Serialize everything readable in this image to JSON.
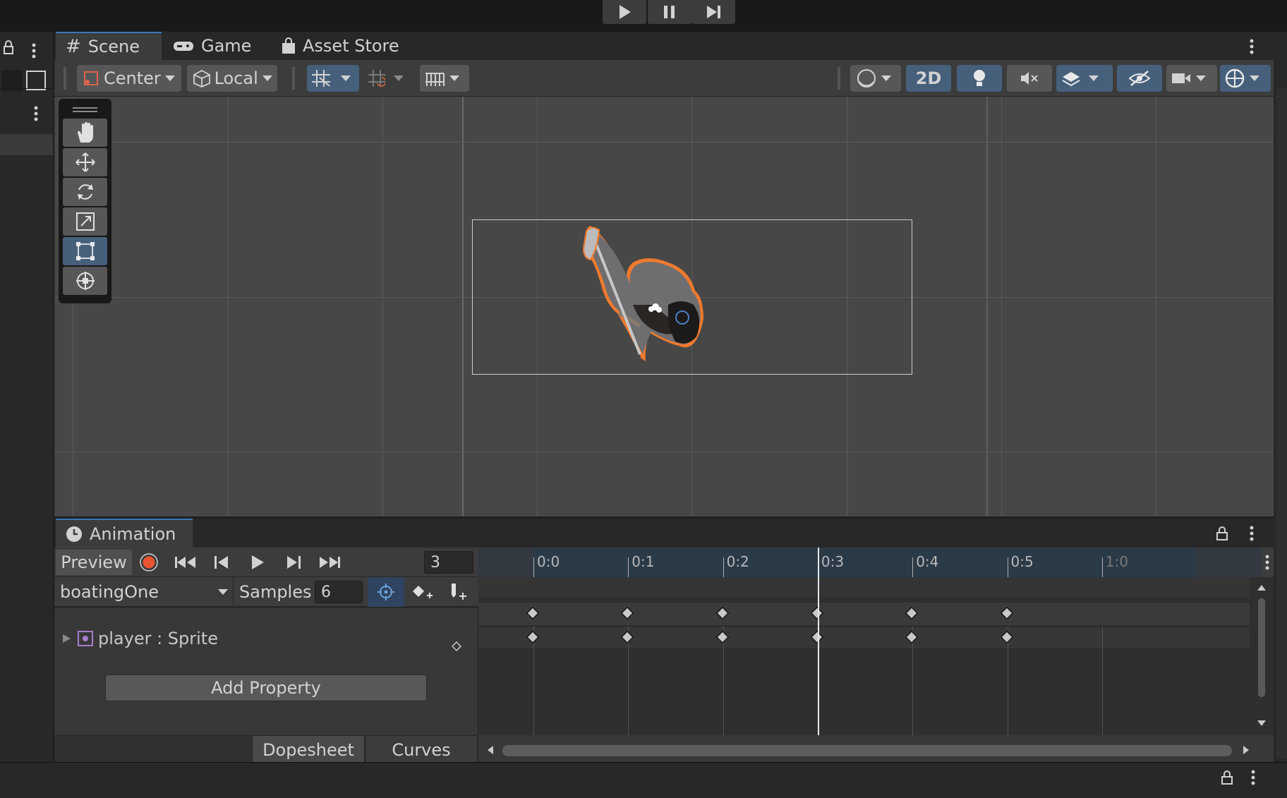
{
  "tabs": [
    "Scene",
    "Game",
    "Asset Store"
  ],
  "toolbar": {
    "pivot": "Center",
    "space": "Local",
    "mode_2d": "2D"
  },
  "animation": {
    "tab": "Animation",
    "preview": "Preview",
    "frame": "3",
    "clip": "boatingOne",
    "samples_label": "Samples",
    "samples": "6",
    "property": "player : Sprite",
    "add_property": "Add Property",
    "dopesheet": "Dopesheet",
    "curves": "Curves",
    "ruler": [
      "0:0",
      "0:1",
      "0:2",
      "0:3",
      "0:4",
      "0:5",
      "1:0"
    ],
    "playhead_frame": 3,
    "keyframes": [
      0,
      1,
      2,
      3,
      4,
      5
    ]
  },
  "colors": {
    "accent": "#46607c",
    "record": "#e8542f",
    "selection_outline": "#f07a2e"
  }
}
